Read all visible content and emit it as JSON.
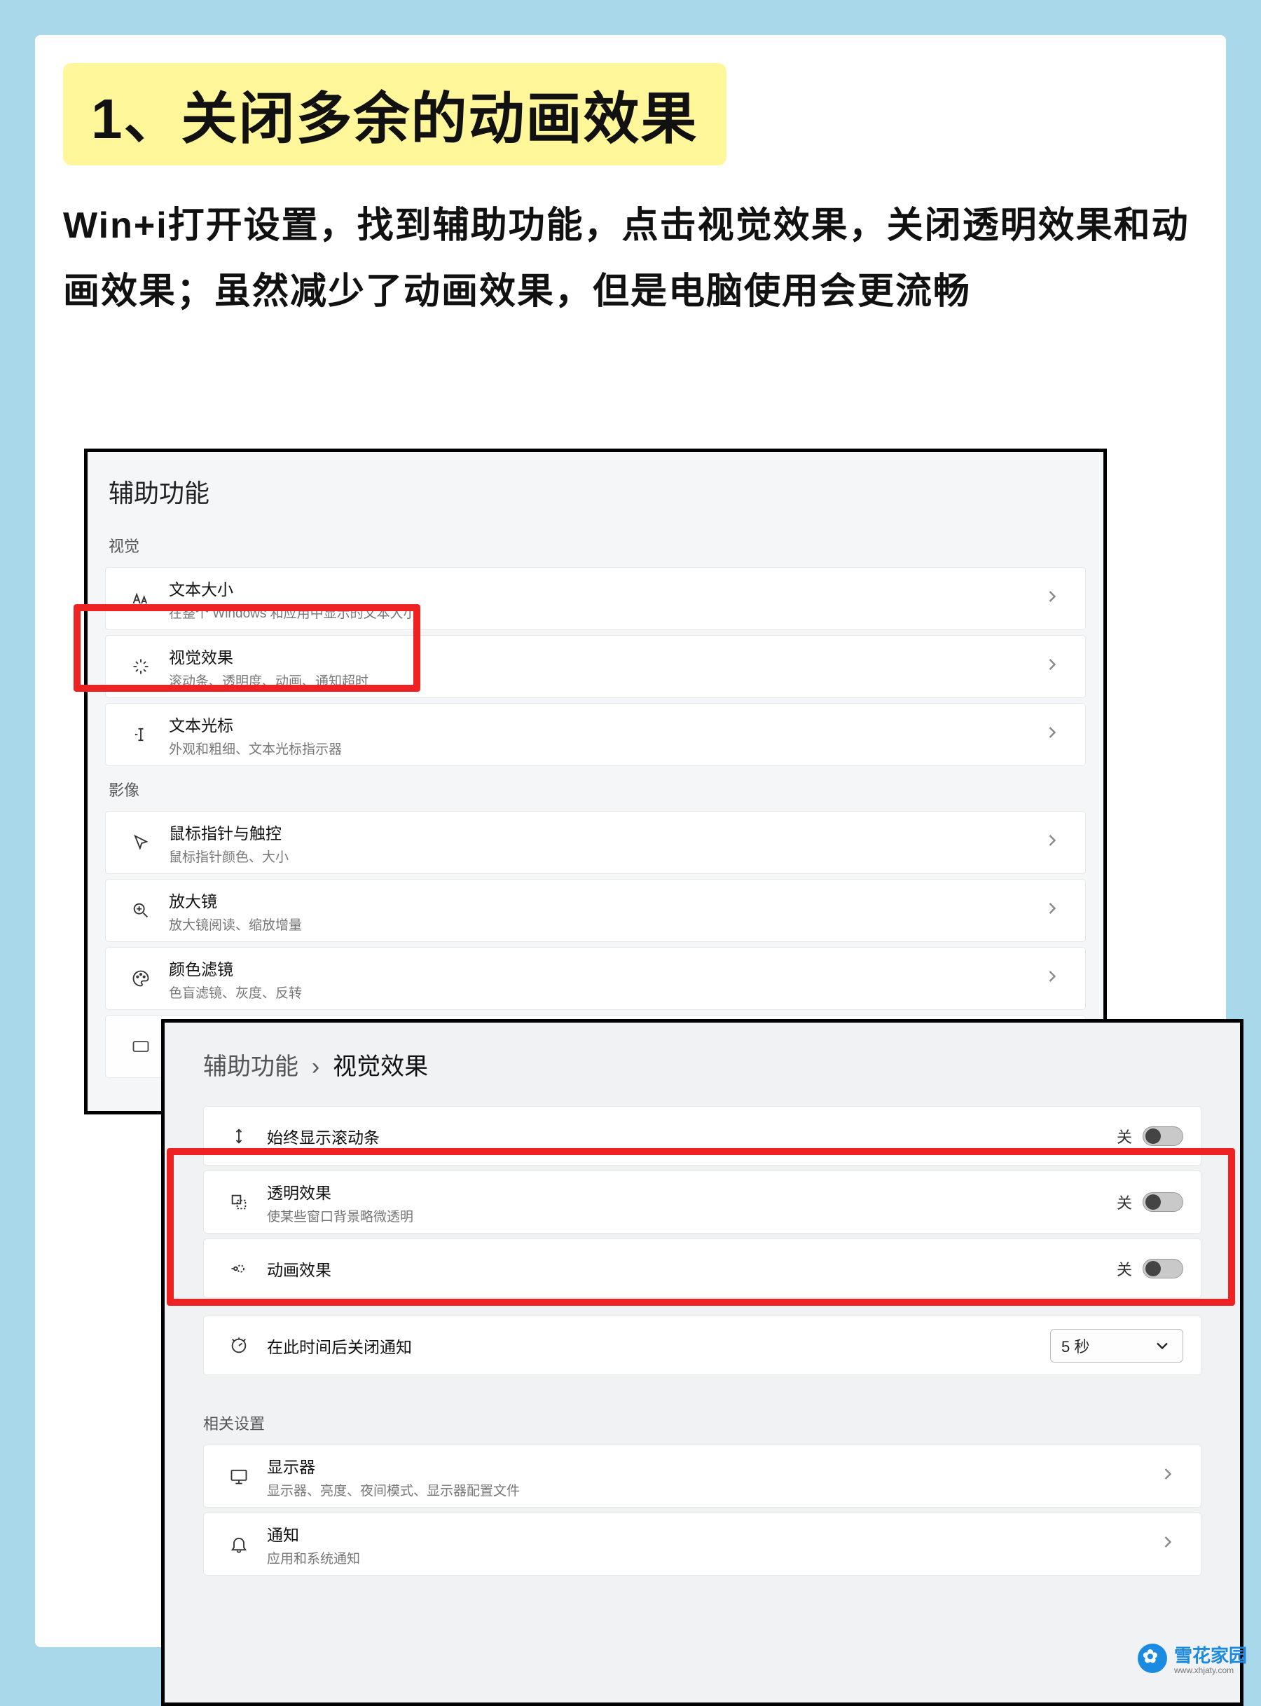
{
  "title": "1、关闭多余的动画效果",
  "instruction": "Win+i打开设置，找到辅助功能，点击视觉效果，关闭透明效果和动画效果；虽然减少了动画效果，但是电脑使用会更流畅",
  "panelA": {
    "title": "辅助功能",
    "section_vision": "视觉",
    "section_image": "影像",
    "items": [
      {
        "title": "文本大小",
        "sub": "在整个 Windows 和应用中显示的文本大小",
        "icon": "text-size-icon"
      },
      {
        "title": "视觉效果",
        "sub": "滚动条、透明度、动画、通知超时",
        "icon": "sparkle-icon"
      },
      {
        "title": "文本光标",
        "sub": "外观和粗细、文本光标指示器",
        "icon": "cursor-text-icon"
      },
      {
        "title": "鼠标指针与触控",
        "sub": "鼠标指针颜色、大小",
        "icon": "pointer-icon"
      },
      {
        "title": "放大镜",
        "sub": "放大镜阅读、缩放增量",
        "icon": "magnifier-icon"
      },
      {
        "title": "颜色滤镜",
        "sub": "色盲滤镜、灰度、反转",
        "icon": "palette-icon"
      }
    ]
  },
  "panelB": {
    "breadcrumb_root": "辅助功能",
    "breadcrumb_sep": "›",
    "breadcrumb_current": "视觉效果",
    "off_label": "关",
    "rows": [
      {
        "title": "始终显示滚动条",
        "icon": "scrollbar-icon",
        "type": "toggle"
      },
      {
        "title": "透明效果",
        "sub": "使某些窗口背景略微透明",
        "icon": "transparency-icon",
        "type": "toggle"
      },
      {
        "title": "动画效果",
        "icon": "animation-icon",
        "type": "toggle"
      },
      {
        "title": "在此时间后关闭通知",
        "icon": "timer-icon",
        "type": "select",
        "value": "5 秒"
      }
    ],
    "related_label": "相关设置",
    "related": [
      {
        "title": "显示器",
        "sub": "显示器、亮度、夜间模式、显示器配置文件",
        "icon": "monitor-icon"
      },
      {
        "title": "通知",
        "sub": "应用和系统通知",
        "icon": "bell-icon"
      }
    ]
  },
  "watermark": {
    "name": "雪花家园",
    "url": "www.xhjaty.com"
  }
}
